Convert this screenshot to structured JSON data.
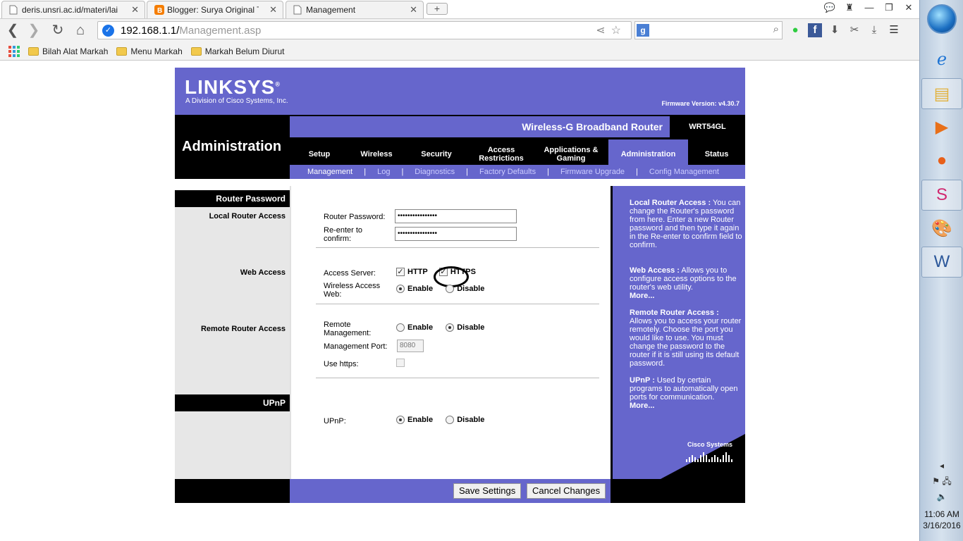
{
  "browser": {
    "tabs": [
      {
        "title": "deris.unsri.ac.id/materi/lai",
        "active": false
      },
      {
        "title": "Blogger: Surya Original TK",
        "active": false
      },
      {
        "title": "Management",
        "active": true
      }
    ],
    "url_host": "192.168.1.1/",
    "url_path": "Management.asp",
    "bookmarks": [
      "Bilah Alat Markah",
      "Menu Markah",
      "Markah Belum Diurut"
    ]
  },
  "router": {
    "brand": "LINKSYS",
    "brand_mark": "®",
    "brand_sub": "A Division of Cisco Systems, Inc.",
    "firmware": "Firmware Version: v4.30.7",
    "section_title": "Administration",
    "product_name": "Wireless-G Broadband Router",
    "model": "WRT54GL",
    "menu": [
      {
        "label": "Setup",
        "active": false
      },
      {
        "label": "Wireless",
        "active": false
      },
      {
        "label": "Security",
        "active": false
      },
      {
        "label": "Access Restrictions",
        "active": false
      },
      {
        "label": "Applications & Gaming",
        "active": false
      },
      {
        "label": "Administration",
        "active": true
      },
      {
        "label": "Status",
        "active": false
      }
    ],
    "submenu": [
      "Management",
      "Log",
      "Diagnostics",
      "Factory Defaults",
      "Firmware Upgrade",
      "Config Management"
    ],
    "left": {
      "router_password_head": "Router Password",
      "local_router_access": "Local Router Access",
      "web_access": "Web Access",
      "remote_router_access": "Remote Router Access",
      "upnp_head": "UPnP"
    },
    "form": {
      "router_password_label": "Router Password:",
      "router_password_value": "••••••••••••••••",
      "reenter_label_1": "Re-enter to",
      "reenter_label_2": "confirm:",
      "reenter_value": "••••••••••••••••",
      "access_server_label": "Access Server:",
      "http_label": "HTTP",
      "https_label": "HTTPS",
      "wireless_access_label_1": "Wireless Access",
      "wireless_access_label_2": "Web:",
      "enable": "Enable",
      "disable": "Disable",
      "remote_mgmt_label_1": "Remote",
      "remote_mgmt_label_2": "Management:",
      "mgmt_port_label": "Management Port:",
      "mgmt_port_value": "8080",
      "use_https_label": "Use https:",
      "upnp_label": "UPnP:"
    },
    "help": {
      "local_title": "Local Router Access :",
      "local_text": "You can change the Router's password from here. Enter a new Router password and then type it again in the Re-enter to confirm field to confirm.",
      "web_title": "Web Access :",
      "web_text": "Allows you to configure access options to the router's web utility.",
      "more": "More...",
      "remote_title": "Remote Router Access :",
      "remote_text": "Allows you to access your router remotely. Choose the port you would like to use. You must change the password to the router if it is still using its default password.",
      "upnp_title": "UPnP :",
      "upnp_text": "Used by certain programs to automatically open ports for communication.",
      "cisco": "Cisco Systems"
    },
    "buttons": {
      "save": "Save Settings",
      "cancel": "Cancel Changes"
    }
  },
  "taskbar": {
    "time": "11:06 AM",
    "date": "3/16/2016"
  }
}
